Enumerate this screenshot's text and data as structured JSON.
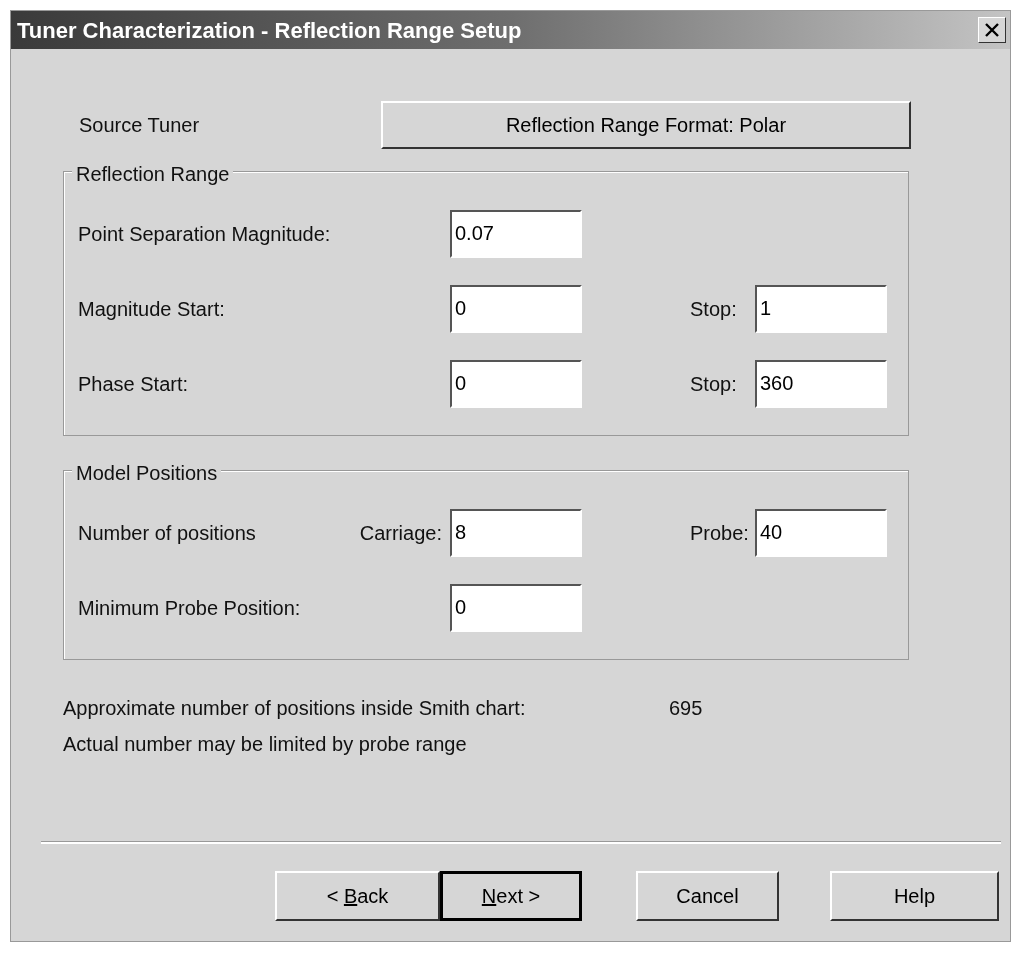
{
  "window": {
    "title": "Tuner Characterization - Reflection Range Setup"
  },
  "source": {
    "label": "Source Tuner",
    "format_button": "Reflection Range Format: Polar"
  },
  "reflection_range": {
    "legend": "Reflection Range",
    "rows": [
      {
        "label": "Point Separation Magnitude:",
        "value": "0.07"
      },
      {
        "label": "Magnitude Start:",
        "value": "0",
        "stop_label": "Stop:",
        "stop_value": "1"
      },
      {
        "label": "Phase Start:",
        "value": "0",
        "stop_label": "Stop:",
        "stop_value": "360"
      }
    ]
  },
  "model_positions": {
    "legend": "Model Positions",
    "rows": [
      {
        "label": "Number of positions",
        "sublabel": "Carriage:",
        "value": "8",
        "stop_label": "Probe:",
        "stop_value": "40"
      },
      {
        "label": "Minimum Probe Position:",
        "value": "0"
      }
    ]
  },
  "summary": {
    "label": "Approximate number of positions inside Smith chart:",
    "value": "695",
    "note": "Actual number may be limited by probe range"
  },
  "buttons": [
    {
      "before": "< ",
      "key": "B",
      "after": "ack",
      "default": false
    },
    {
      "key": "N",
      "after": "ext >",
      "default": true
    },
    {
      "before": "Cancel",
      "default": false
    },
    {
      "before": "Help",
      "default": false
    }
  ]
}
